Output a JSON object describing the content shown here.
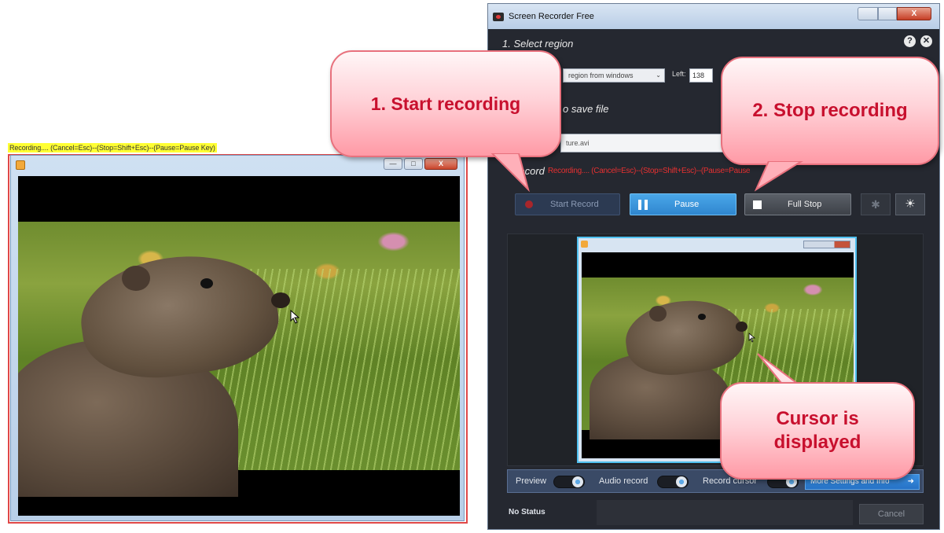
{
  "left_window": {
    "hint_text": "Recording.... (Cancel=Esc)--(Stop=Shift+Esc)--(Pause=Pause Key)",
    "buttons": {
      "minimize": "—",
      "maximize": "□",
      "close": "X"
    }
  },
  "recorder": {
    "title": "Screen Recorder Free",
    "close_glyph": "X",
    "section1_title": "1. Select region",
    "help_glyph": "?",
    "close_round_glyph": "✕",
    "region_select_value": "region from windows",
    "left_label": "Left:",
    "left_value": "138",
    "section2_title": "o save file",
    "file_value": "ture.avi",
    "record_title": "Record",
    "record_status": "Recording.... (Cancel=Esc)--(Stop=Shift+Esc)--(Pause=Pause",
    "start_label": "Start Record",
    "pause_label": "Pause",
    "stop_label": "Full Stop",
    "tools_glyph": "✱",
    "settings_glyph": "☀",
    "preview_label": "Preview",
    "audio_label": "Audio record",
    "record_cursor_label": "Record cursor",
    "more_label": "More Settings and Info",
    "status_label": "No Status",
    "cancel_label": "Cancel"
  },
  "callouts": {
    "start": "1. Start recording",
    "stop": "2. Stop recording",
    "cursor_line1": "Cursor is",
    "cursor_line2": "displayed"
  },
  "colors": {
    "callout_text": "#c8102e",
    "recording_border": "#e04848",
    "app_background": "#252830",
    "pause_accent": "#2f86cf"
  }
}
